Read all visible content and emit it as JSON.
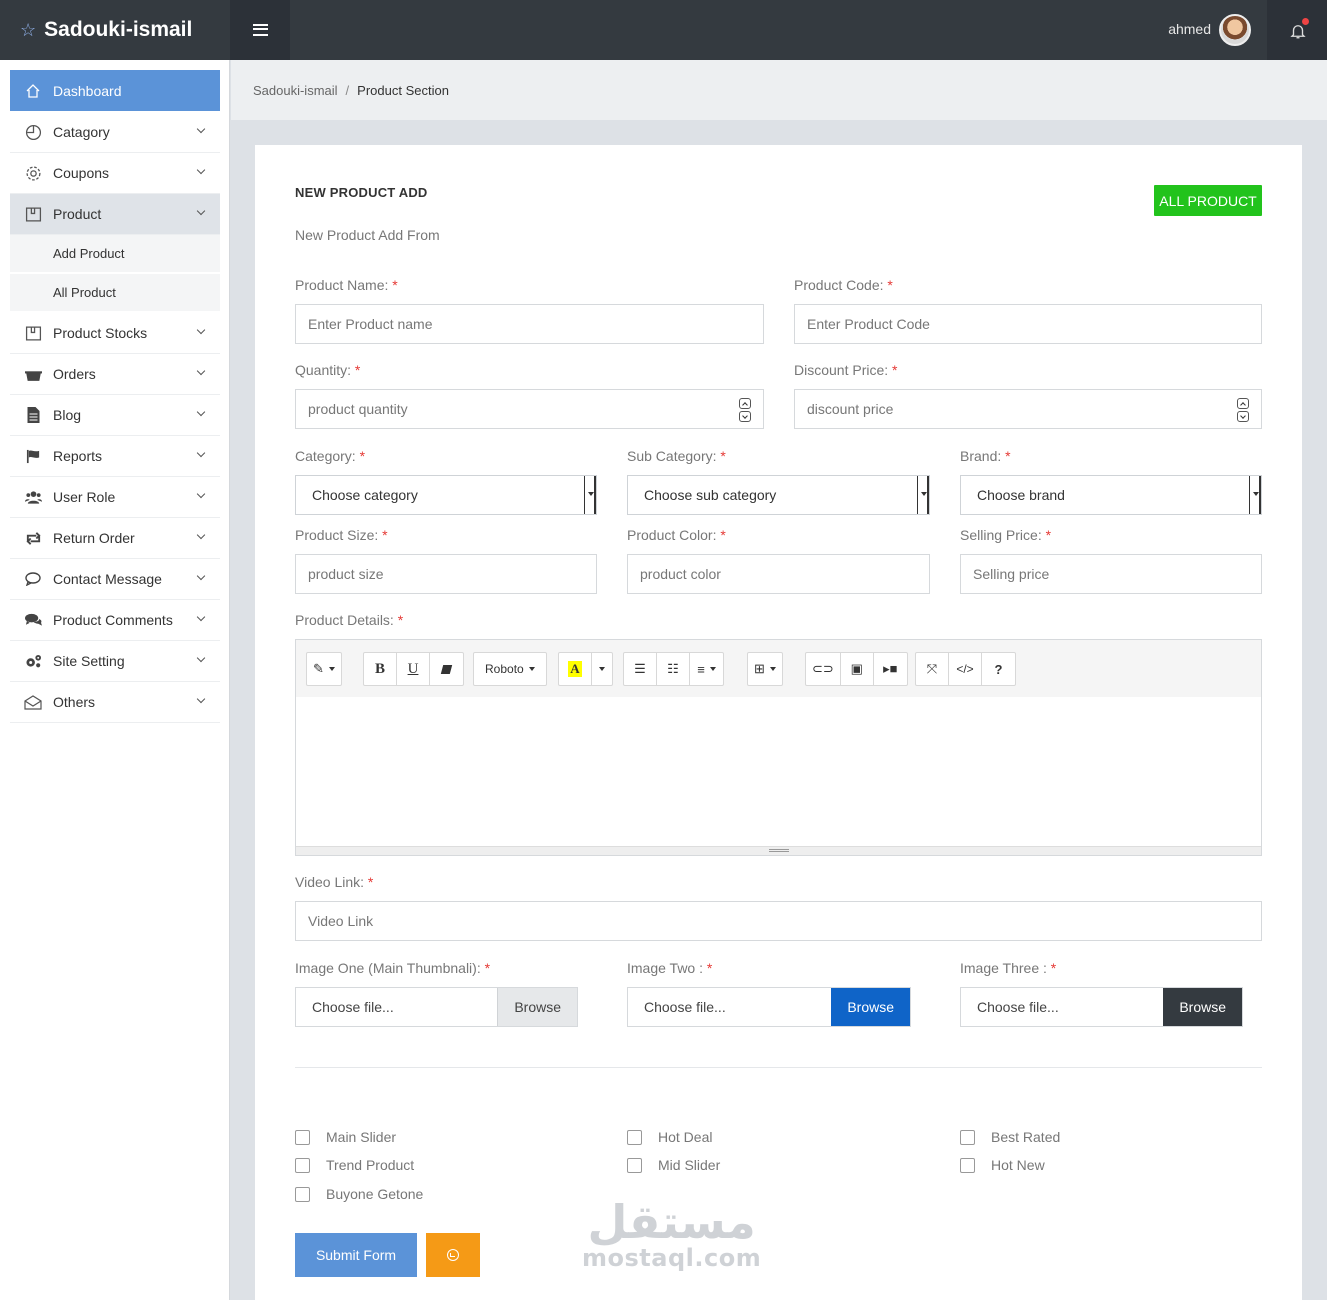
{
  "brand": {
    "name": "Sadouki-ismail"
  },
  "header": {
    "user_name": "ahmed"
  },
  "sidebar": {
    "items": [
      {
        "label": "Dashboard"
      },
      {
        "label": "Catagory"
      },
      {
        "label": "Coupons"
      },
      {
        "label": "Product"
      },
      {
        "label": "Product Stocks"
      },
      {
        "label": "Orders"
      },
      {
        "label": "Blog"
      },
      {
        "label": "Reports"
      },
      {
        "label": "User Role"
      },
      {
        "label": "Return Order"
      },
      {
        "label": "Contact Message"
      },
      {
        "label": "Product Comments"
      },
      {
        "label": "Site Setting"
      },
      {
        "label": "Others"
      }
    ],
    "product_sub": [
      {
        "label": "Add Product"
      },
      {
        "label": "All Product"
      }
    ]
  },
  "breadcrumb": {
    "root": "Sadouki-ismail",
    "sep": "/",
    "current": "Product Section"
  },
  "form": {
    "title": "NEW PRODUCT ADD",
    "subtitle": "New Product Add From",
    "all_button": "ALL PRODUCT",
    "required_mark": "*",
    "fields": {
      "product_name": {
        "label": "Product Name:",
        "placeholder": "Enter Product name"
      },
      "product_code": {
        "label": "Product Code:",
        "placeholder": "Enter Product Code"
      },
      "quantity": {
        "label": "Quantity:",
        "placeholder": "product quantity"
      },
      "discount_price": {
        "label": "Discount Price:",
        "placeholder": "discount price"
      },
      "category": {
        "label": "Category:",
        "value": "Choose category"
      },
      "sub_category": {
        "label": "Sub Category:",
        "value": "Choose sub category"
      },
      "brand": {
        "label": "Brand:",
        "value": "Choose brand"
      },
      "product_size": {
        "label": "Product Size:",
        "placeholder": "product size"
      },
      "product_color": {
        "label": "Product Color:",
        "placeholder": "product color"
      },
      "selling_price": {
        "label": "Selling Price:",
        "placeholder": "Selling price"
      },
      "product_details": {
        "label": "Product Details:"
      },
      "video_link": {
        "label": "Video Link:",
        "placeholder": "Video Link"
      },
      "image_one": {
        "label": "Image One (Main Thumbnali):",
        "file_text": "Choose file...",
        "button": "Browse"
      },
      "image_two": {
        "label": "Image Two :",
        "file_text": "Choose file...",
        "button": "Browse"
      },
      "image_three": {
        "label": "Image Three :",
        "file_text": "Choose file...",
        "button": "Browse"
      }
    },
    "editor": {
      "font_name": "Roboto"
    },
    "checkboxes": [
      {
        "label": "Main Slider",
        "checked": false
      },
      {
        "label": "Hot Deal",
        "checked": false
      },
      {
        "label": "Best Rated",
        "checked": false
      },
      {
        "label": "Trend Product",
        "checked": false
      },
      {
        "label": "Mid Slider",
        "checked": false
      },
      {
        "label": "Hot New",
        "checked": false
      },
      {
        "label": "Buyone Getone",
        "checked": false
      }
    ],
    "submit_label": "Submit Form"
  },
  "watermark": {
    "arabic": "مستقل",
    "latin": "mostaql.com"
  },
  "colors": {
    "header_bg": "#343a40",
    "accent": "#5b93d8",
    "success": "#22c31c",
    "warning": "#f59a16",
    "primary_dark": "#0f64c8",
    "required": "#e53935"
  }
}
